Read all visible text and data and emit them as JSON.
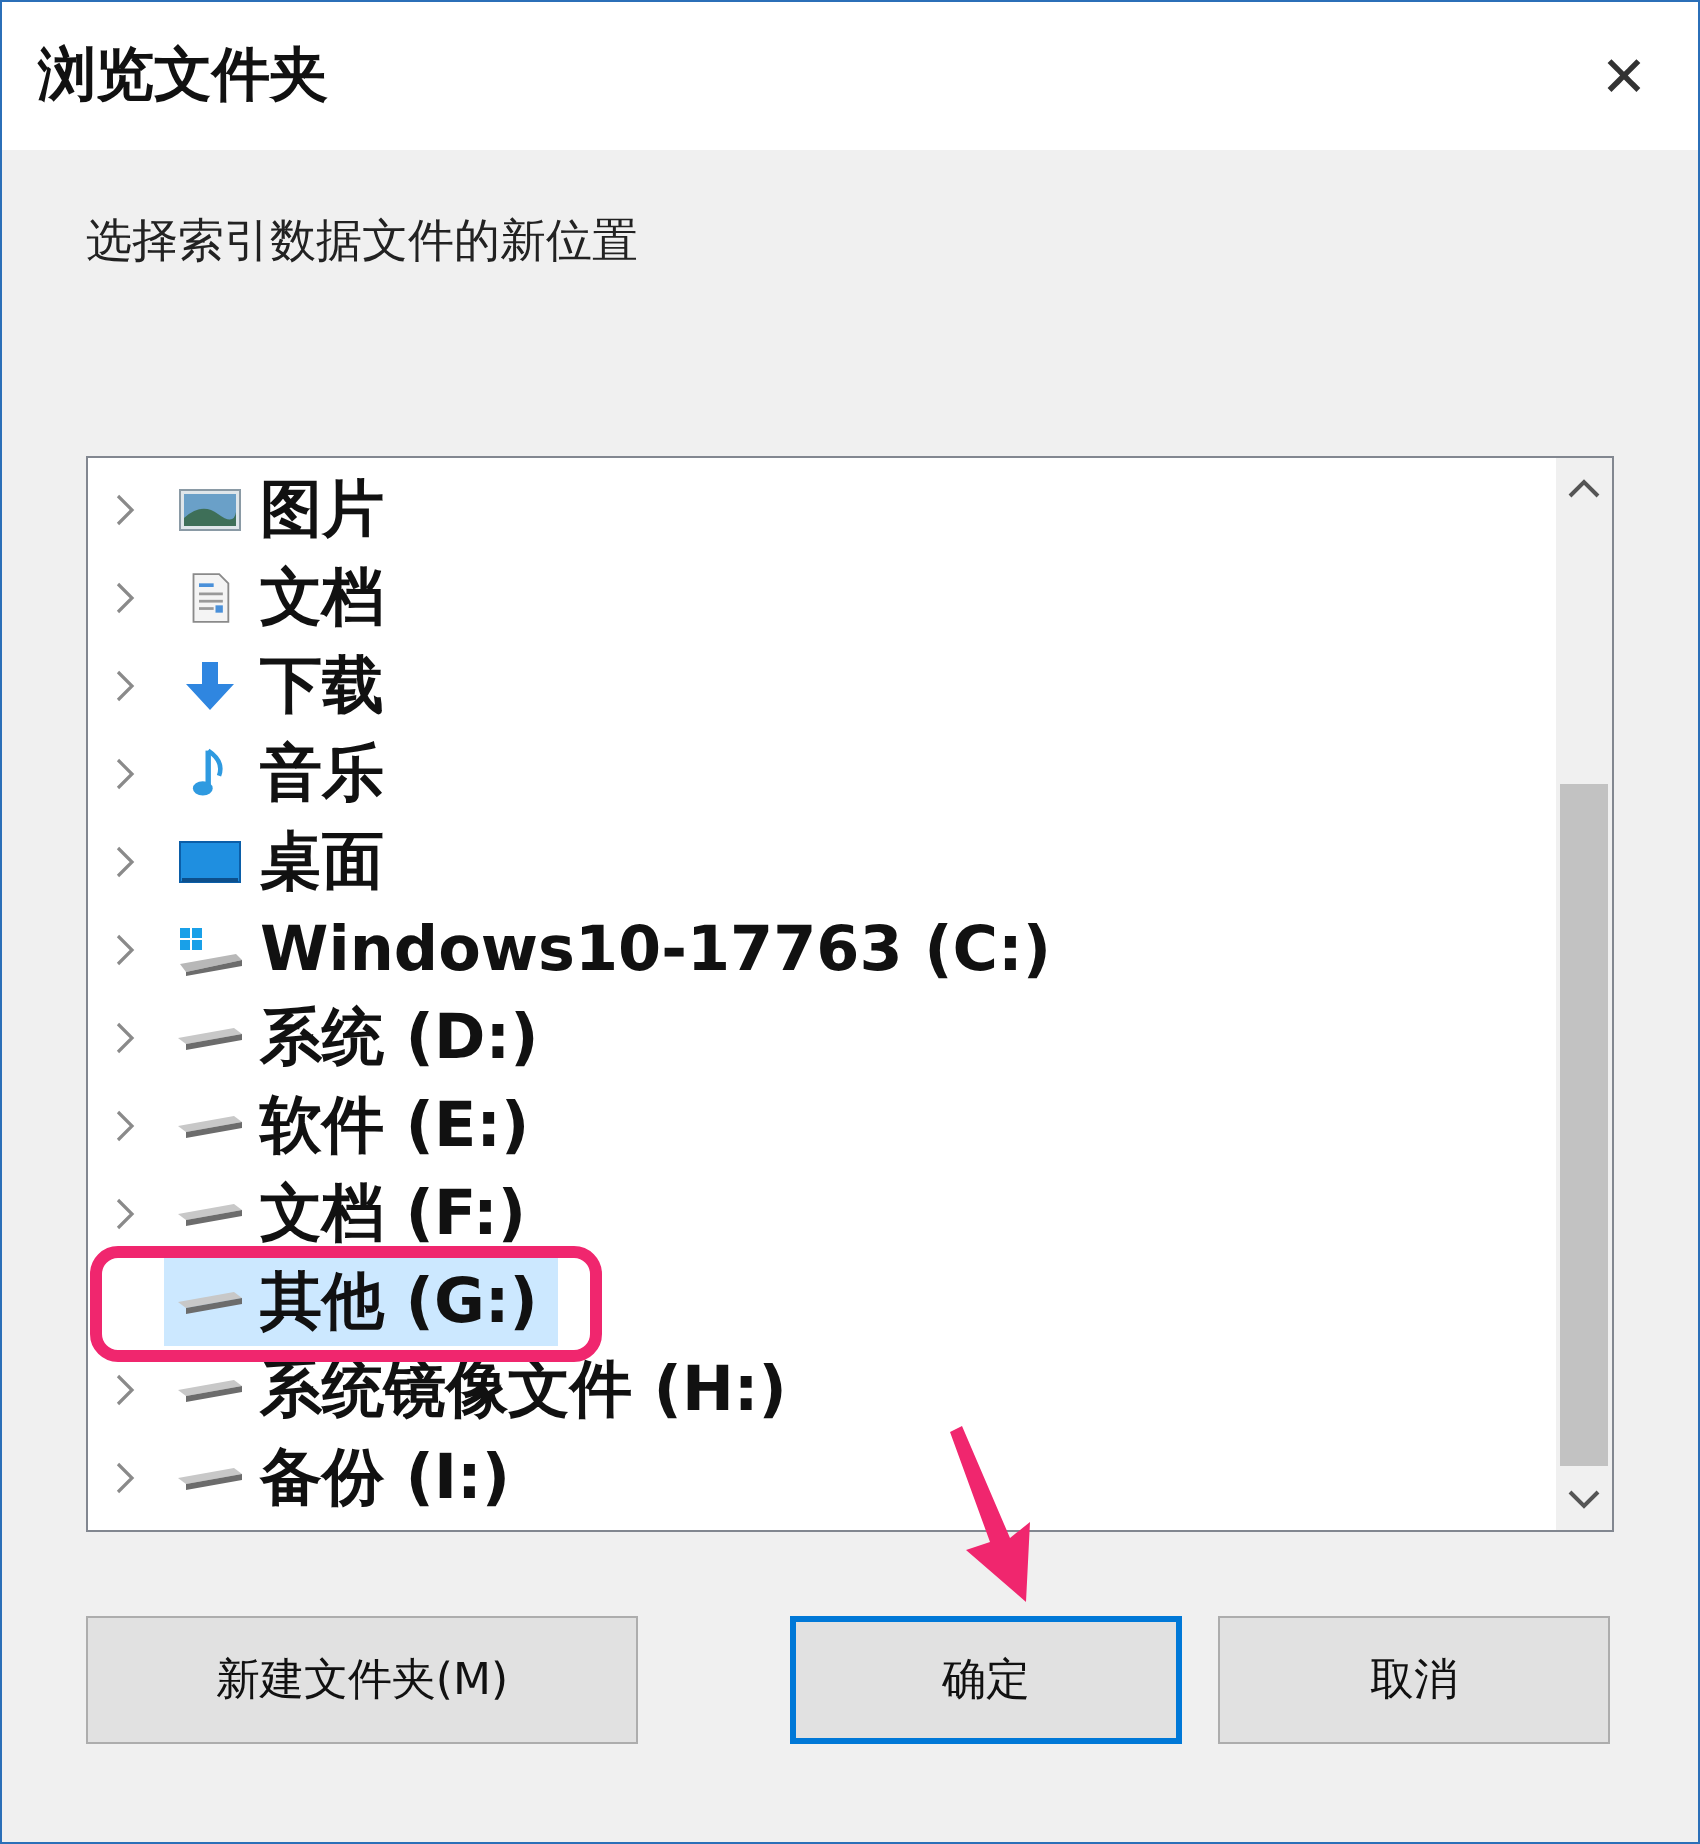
{
  "window": {
    "title": "浏览文件夹",
    "close": "✕"
  },
  "description": "选择索引数据文件的新位置",
  "tree": {
    "items": [
      {
        "label": "图片",
        "kind": "pictures",
        "expander": true,
        "selected": false
      },
      {
        "label": "文档",
        "kind": "documents",
        "expander": true,
        "selected": false
      },
      {
        "label": "下载",
        "kind": "downloads",
        "expander": true,
        "selected": false
      },
      {
        "label": "音乐",
        "kind": "music",
        "expander": true,
        "selected": false
      },
      {
        "label": "桌面",
        "kind": "desktop",
        "expander": true,
        "selected": false
      },
      {
        "label": "Windows10-17763 (C:)",
        "kind": "windows-drive",
        "expander": true,
        "selected": false
      },
      {
        "label": "系统 (D:)",
        "kind": "drive",
        "expander": true,
        "selected": false
      },
      {
        "label": "软件 (E:)",
        "kind": "drive",
        "expander": true,
        "selected": false
      },
      {
        "label": "文档 (F:)",
        "kind": "drive",
        "expander": true,
        "selected": false
      },
      {
        "label": "其他 (G:)",
        "kind": "drive",
        "expander": false,
        "selected": true
      },
      {
        "label": "系统镜像文件 (H:)",
        "kind": "drive",
        "expander": true,
        "selected": false
      },
      {
        "label": "备份 (I:)",
        "kind": "drive",
        "expander": true,
        "selected": false
      }
    ]
  },
  "buttons": [
    {
      "label": "新建文件夹(M)",
      "default": false
    },
    {
      "label": "确定",
      "default": true
    },
    {
      "label": "取消",
      "default": false
    }
  ],
  "callouts": {
    "frame_around_selected": true,
    "arrow_to_default_button": true
  }
}
